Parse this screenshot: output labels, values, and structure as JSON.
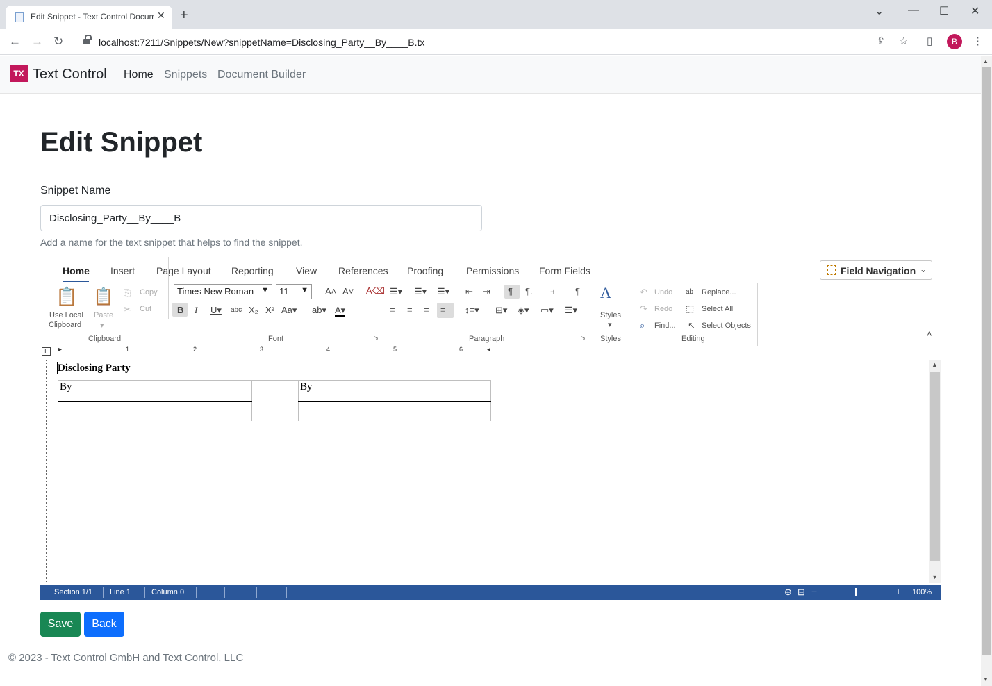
{
  "browser": {
    "tab_title": "Edit Snippet - Text Control Docum",
    "url": "localhost:7211/Snippets/New?snippetName=Disclosing_Party__By____B.tx",
    "avatar_letter": "B"
  },
  "navbar": {
    "brand_logo": "TX",
    "brand_name": "Text Control",
    "links": [
      "Home",
      "Snippets",
      "Document Builder"
    ]
  },
  "page": {
    "title": "Edit Snippet",
    "name_label": "Snippet Name",
    "name_value": "Disclosing_Party__By____B",
    "name_hint": "Add a name for the text snippet that helps to find the snippet."
  },
  "ribbon": {
    "tabs": [
      "Home",
      "Insert",
      "Page Layout",
      "Reporting",
      "View",
      "References",
      "Proofing",
      "Permissions",
      "Form Fields"
    ],
    "field_navigation": "Field Navigation",
    "clipboard": {
      "use_local": "Use Local",
      "clipboard": "Clipboard",
      "paste": "Paste",
      "copy": "Copy",
      "cut": "Cut",
      "group": "Clipboard"
    },
    "font": {
      "family": "Times New Roman",
      "size": "11",
      "group": "Font"
    },
    "paragraph": {
      "group": "Paragraph"
    },
    "styles": {
      "label": "Styles",
      "group": "Styles"
    },
    "editing": {
      "undo": "Undo",
      "redo": "Redo",
      "find": "Find...",
      "replace": "Replace...",
      "select_all": "Select All",
      "select_objects": "Select Objects",
      "group": "Editing"
    }
  },
  "ruler": {
    "numbers": [
      "1",
      "2",
      "3",
      "4",
      "5",
      "6"
    ]
  },
  "document": {
    "heading": "Disclosing Party",
    "table": [
      [
        "By",
        "",
        "By"
      ],
      [
        "",
        "",
        ""
      ]
    ]
  },
  "statusbar": {
    "section": "Section 1/1",
    "line": "Line 1",
    "column": "Column 0",
    "zoom": "100%"
  },
  "buttons": {
    "save": "Save",
    "back": "Back"
  },
  "footer": "© 2023 - Text Control GmbH and Text Control, LLC",
  "colors": {
    "brand": "#c2185b",
    "save": "#198754",
    "back": "#0d6efd",
    "statusbar": "#2b579a"
  }
}
